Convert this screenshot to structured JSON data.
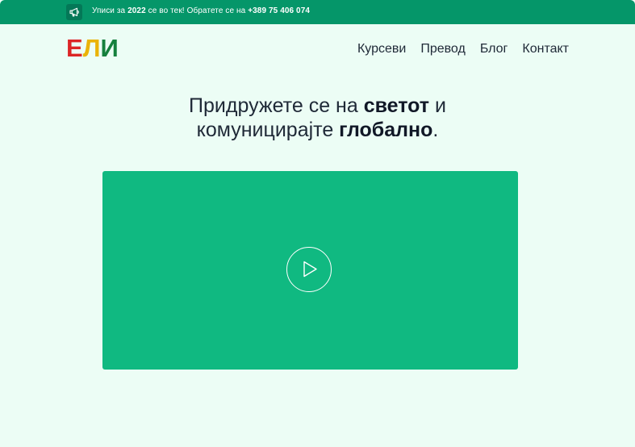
{
  "announcement": {
    "icon": "megaphone-icon",
    "prefix": "Уписи за ",
    "year": "2022",
    "middle": " се во тек! Обратете се на ",
    "phone": "+389 75 406 074"
  },
  "logo": {
    "letters": [
      "Е",
      "Л",
      "И"
    ],
    "colors": [
      "#dc2626",
      "#eab308",
      "#15803d"
    ]
  },
  "nav": {
    "items": [
      "Курсеви",
      "Превод",
      "Блог",
      "Контакт"
    ]
  },
  "hero": {
    "part1": "Придружете се на ",
    "bold1": "светот",
    "part2": " и",
    "part3": "комуницирајте ",
    "bold2": "глобално",
    "part4": "."
  },
  "video": {
    "icon": "play-icon"
  },
  "colors": {
    "topbar": "#059669",
    "background": "#ecfdf5",
    "video": "#10b981"
  }
}
